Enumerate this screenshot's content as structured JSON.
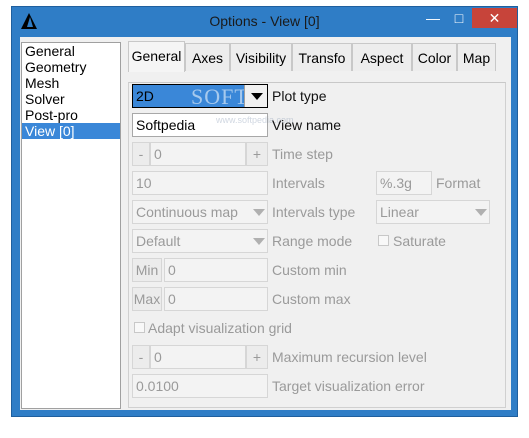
{
  "window": {
    "title": "Options - View [0]",
    "min_glyph": "—",
    "max_glyph": "□",
    "close_glyph": "✕"
  },
  "tree": {
    "items": [
      "General",
      "Geometry",
      "Mesh",
      "Solver",
      "Post-pro",
      "View [0]"
    ],
    "selected": "View [0]"
  },
  "tabs": {
    "items": [
      "General",
      "Axes",
      "Visibility",
      "Transfo",
      "Aspect",
      "Color",
      "Map"
    ],
    "active": "General"
  },
  "form": {
    "plot_type": {
      "value": "2D",
      "label": "Plot type"
    },
    "view_name": {
      "value": "Softpedia",
      "label": "View name"
    },
    "time_step": {
      "minus": "-",
      "value": "0",
      "plus": "+",
      "label": "Time step"
    },
    "intervals": {
      "value": "10",
      "label": "Intervals",
      "format_value": "%.3g",
      "format_label": "Format"
    },
    "intervals_type": {
      "value": "Continuous map",
      "label": "Intervals type",
      "type_value": "Linear"
    },
    "range_mode": {
      "value": "Default",
      "label": "Range mode",
      "saturate_label": "Saturate",
      "saturate_checked": false
    },
    "custom_min": {
      "button": "Min",
      "value": "0",
      "label": "Custom min"
    },
    "custom_max": {
      "button": "Max",
      "value": "0",
      "label": "Custom max"
    },
    "adapt_grid": {
      "label": "Adapt visualization grid",
      "checked": false
    },
    "max_recursion": {
      "minus": "-",
      "value": "0",
      "plus": "+",
      "label": "Maximum recursion level"
    },
    "target_error": {
      "value": "0.0100",
      "label": "Target visualization error"
    }
  },
  "watermark": {
    "text": "SOFT",
    "url": "www.softpedia.com"
  },
  "colors": {
    "accent": "#3a87d8",
    "frame": "#2f7dc6",
    "close": "#c7443a"
  }
}
